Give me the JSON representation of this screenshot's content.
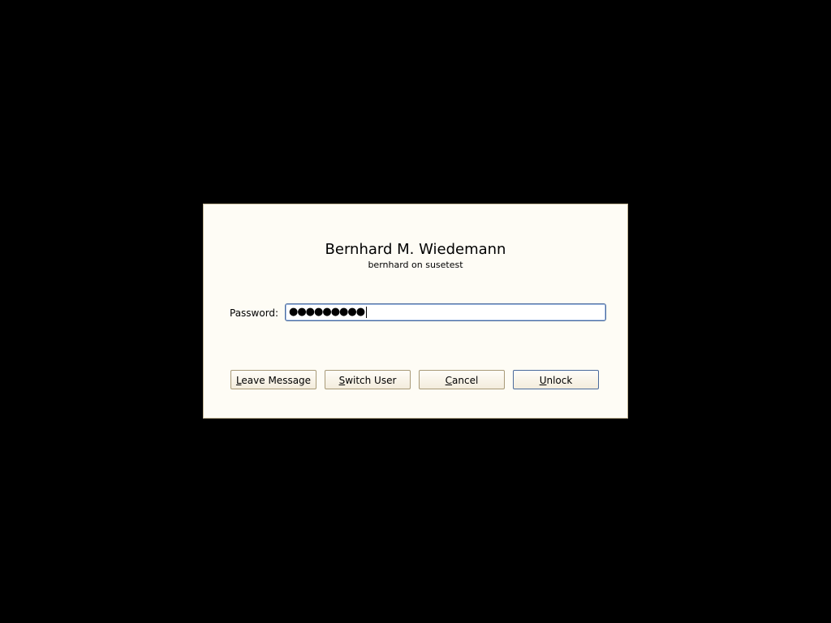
{
  "dialog": {
    "user_full_name": "Bernhard M. Wiedemann",
    "user_host": "bernhard on susetest",
    "password_label": "Password:",
    "password_value": "●●●●●●●●●"
  },
  "buttons": {
    "leave_message": {
      "mnemonic": "L",
      "rest": "eave Message"
    },
    "switch_user": {
      "mnemonic": "S",
      "rest": "witch User"
    },
    "cancel": {
      "mnemonic": "C",
      "rest": "ancel"
    },
    "unlock": {
      "mnemonic": "U",
      "rest": "nlock"
    }
  },
  "colors": {
    "background": "#000000",
    "dialog_bg": "#fefcf5",
    "focus_border": "#4a6a9c"
  }
}
